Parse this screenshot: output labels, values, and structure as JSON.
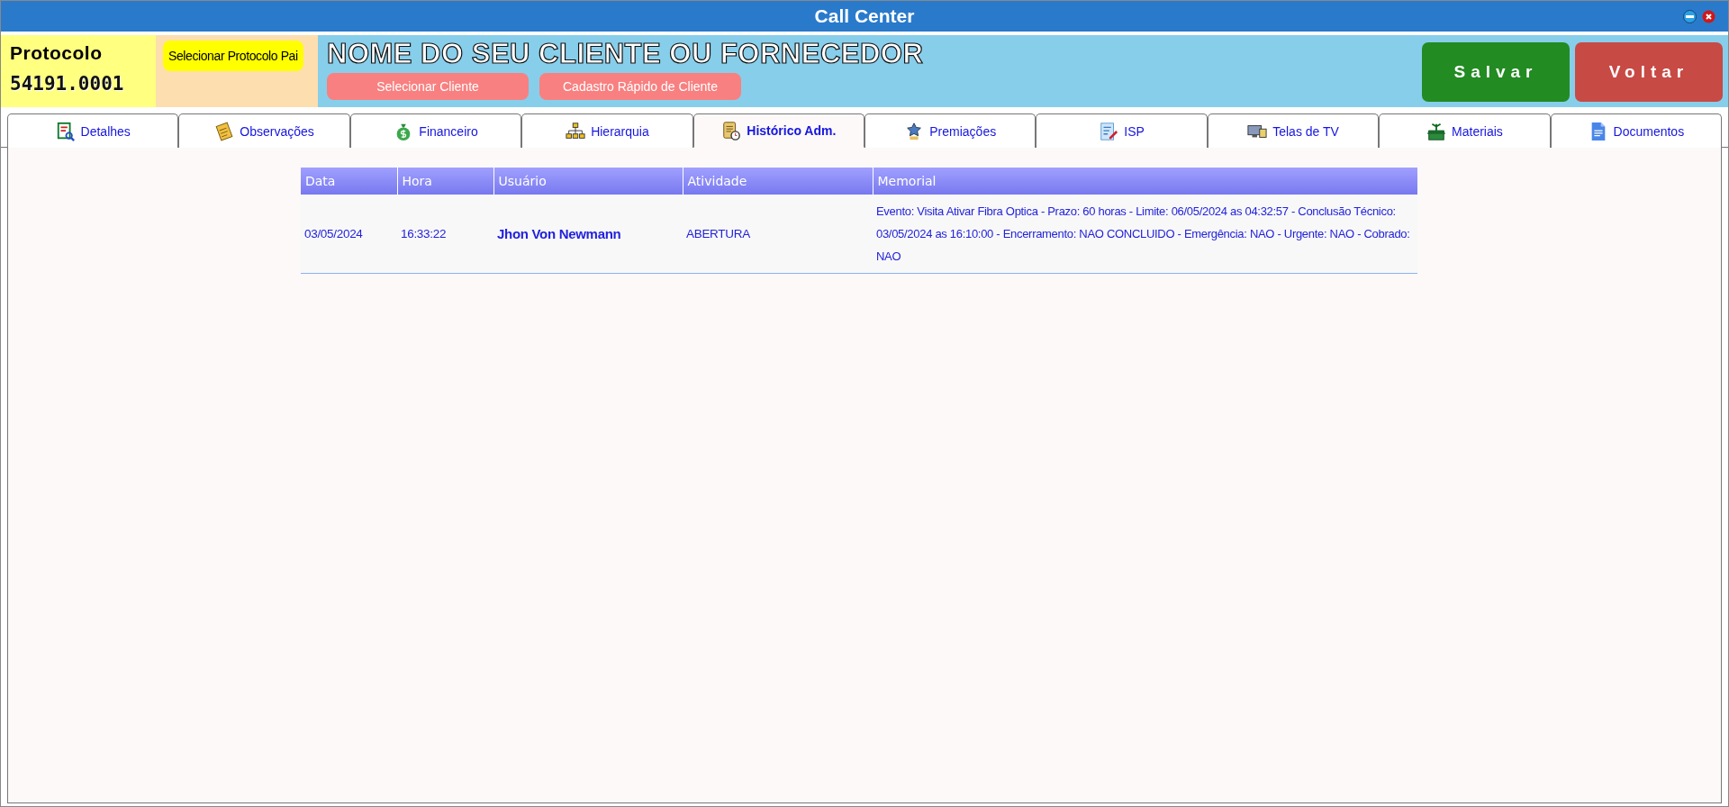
{
  "window": {
    "title": "Call Center"
  },
  "header": {
    "protocol_label": "Protocolo",
    "protocol_number": "54191.0001",
    "parent_button": "Selecionar Protocolo Pai",
    "client_name": "NOME DO SEU CLIENTE OU FORNECEDOR",
    "client_buttons": [
      "Selecionar Cliente",
      "Cadastro Rápido de Cliente"
    ],
    "actions": [
      {
        "label": "Salvar",
        "kind": "save"
      },
      {
        "label": "Voltar",
        "kind": "back"
      }
    ]
  },
  "tabs": [
    {
      "label": "Detalhes",
      "kind": "report",
      "selected": false
    },
    {
      "label": "Observações",
      "kind": "notes",
      "selected": false
    },
    {
      "label": "Financeiro",
      "kind": "money",
      "selected": false
    },
    {
      "label": "Hierarquia",
      "kind": "hierarchy",
      "selected": false
    },
    {
      "label": "Histórico Adm.",
      "kind": "history",
      "selected": true
    },
    {
      "label": "Premiações",
      "kind": "award",
      "selected": false
    },
    {
      "label": "ISP",
      "kind": "edit",
      "selected": false
    },
    {
      "label": "Telas de TV",
      "kind": "screens",
      "selected": false
    },
    {
      "label": "Materiais",
      "kind": "box",
      "selected": false
    },
    {
      "label": "Documentos",
      "kind": "document",
      "selected": false
    }
  ],
  "table": {
    "columns": [
      "Data",
      "Hora",
      "Usuário",
      "Atividade",
      "Memorial"
    ],
    "rows": [
      {
        "data": "03/05/2024",
        "hora": "16:33:22",
        "usuario": "Jhon Von Newmann",
        "atividade": "ABERTURA",
        "memorial": "Evento: Visita Ativar Fibra Optica - Prazo: 60 horas - Limite: 06/05/2024 as 04:32:57 - Conclusão Técnico: 03/05/2024 as 16:10:00 - Encerramento: NAO CONCLUIDO - Emergência: NAO - Urgente: NAO - Cobrado: NAO"
      }
    ]
  }
}
